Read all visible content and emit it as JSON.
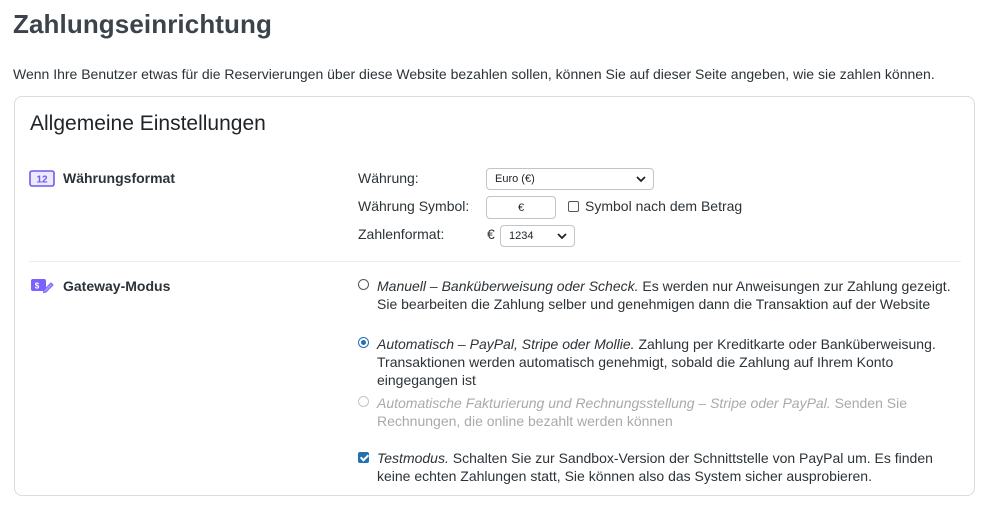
{
  "page": {
    "title": "Zahlungseinrichtung",
    "intro": "Wenn Ihre Benutzer etwas für die Reservierungen über diese Website bezahlen sollen, können Sie auf dieser Seite angeben, wie sie zahlen können."
  },
  "card": {
    "title": "Allgemeine Einstellungen",
    "currency_section": {
      "label": "Währungsformat",
      "icon": "number-12-icon",
      "icon_text": "12",
      "currency_label": "Währung:",
      "currency_value": "Euro (€)",
      "symbol_label": "Währung Symbol:",
      "symbol_value": "€",
      "symbol_after_label": "Symbol nach dem Betrag",
      "symbol_after_checked": false,
      "number_format_label": "Zahlenformat:",
      "number_format_prefix": "€",
      "number_format_value": "1234"
    },
    "gateway_section": {
      "label": "Gateway-Modus",
      "icon": "payment-gateway-icon",
      "options": [
        {
          "title": "Manuell – Banküberweisung oder Scheck.",
          "description": " Es werden nur Anweisungen zur Zahlung gezeigt. Sie bearbeiten die Zahlung selber und genehmigen dann die Transaktion auf der Website",
          "selected": false,
          "disabled": false
        },
        {
          "title": "Automatisch – PayPal, Stripe oder Mollie.",
          "description": " Zahlung per Kreditkarte oder Banküberweisung. Transaktionen werden automatisch genehmigt, sobald die Zahlung auf Ihrem Konto eingegangen ist",
          "selected": true,
          "disabled": false
        },
        {
          "title": "Automatische Fakturierung und Rechnungsstellung – Stripe oder PayPal.",
          "description": " Senden Sie Rechnungen, die online bezahlt werden können",
          "selected": false,
          "disabled": true
        }
      ],
      "test_mode": {
        "title": "Testmodus.",
        "description": " Schalten Sie zur Sandbox-Version der Schnittstelle von PayPal um. Es finden keine echten Zahlungen statt, Sie können also das System sicher ausprobieren.",
        "checked": true
      }
    }
  },
  "colors": {
    "accent": "#2271b1",
    "icon_purple": "#7b61ff"
  }
}
